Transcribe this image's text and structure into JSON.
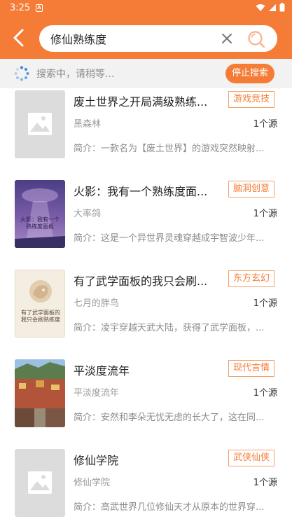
{
  "status_bar": {
    "time": "3:25",
    "notification_badge": "A"
  },
  "search": {
    "query": "修仙熟练度"
  },
  "progress": {
    "text": "搜索中，请稍等...",
    "stop_label": "停止搜索"
  },
  "colors": {
    "accent": "#f47c36",
    "tag_border": "#f0a26a",
    "placeholder_cover": "#dcdcdc"
  },
  "books": [
    {
      "title": "废土世界之开局满级熟练...",
      "tag": "游戏竞技",
      "author": "黑森林",
      "sources": "1个源",
      "intro": "简介：一款名为【废土世界】的游戏突然映射...",
      "cover": "placeholder-image-icon"
    },
    {
      "title": "火影：我有一个熟练度面...",
      "tag": "脑洞创意",
      "author": "大率鸽",
      "sources": "1个源",
      "intro": "简介：这是一个异世界灵魂穿越成宇智波少年...",
      "cover": "naruto-cover",
      "cover_title": "火影：我有一个熟练度面板"
    },
    {
      "title": "有了武学面板的我只会刷...",
      "tag": "东方玄幻",
      "author": "七月的胖鸟",
      "sources": "1个源",
      "intro": "简介：凌宇穿越天武大陆，获得了武学面板，...",
      "cover": "martial-cover",
      "cover_title": "有了武学面板的我只会刷熟练度"
    },
    {
      "title": "平淡度流年",
      "tag": "现代言情",
      "author": "平淡度流年",
      "sources": "1个源",
      "intro": "简介：安然和李朵无忧无虑的长大了，这在同...",
      "cover": "street-photo-cover"
    },
    {
      "title": "修仙学院",
      "tag": "武侠仙侠",
      "author": "修仙学院",
      "sources": "1个源",
      "intro": "简介：高武世界几位修仙天才从原本的世界穿...",
      "cover": "placeholder-image-icon"
    }
  ]
}
